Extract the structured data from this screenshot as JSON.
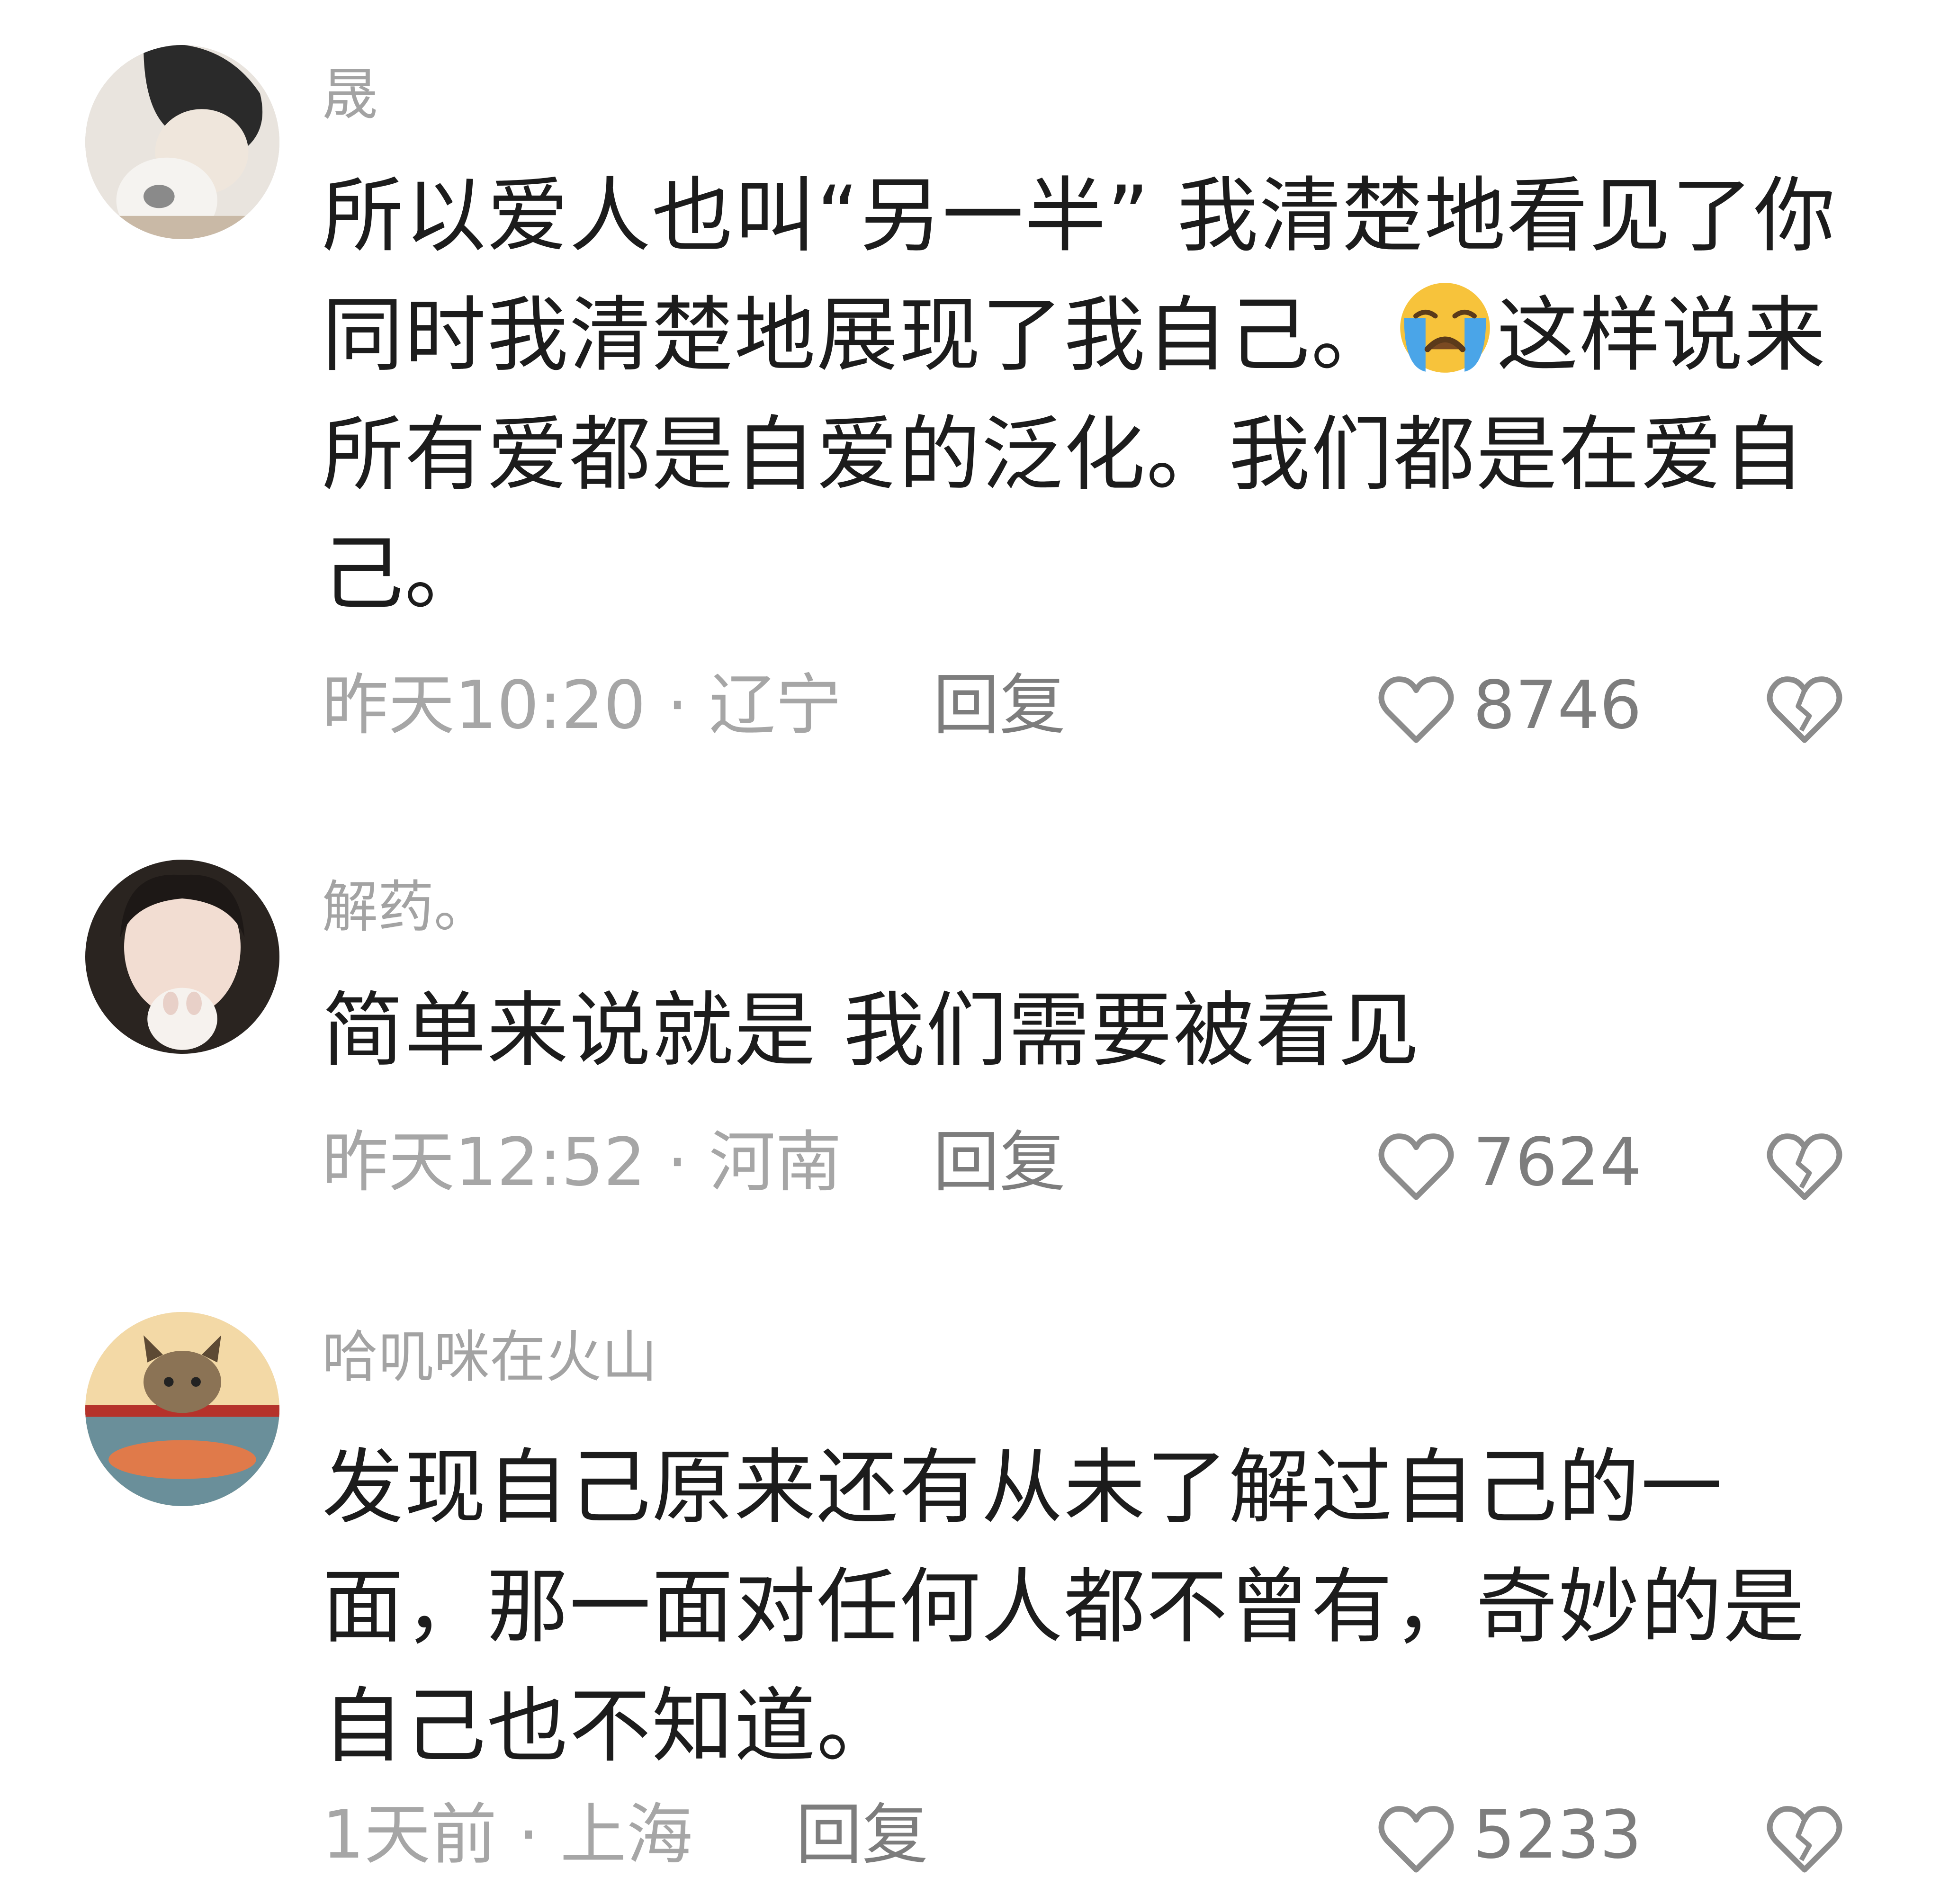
{
  "comments": [
    {
      "username": "晟",
      "text_before_emoji": "所以爱人也叫“另一半” 我清楚地看见了你同时我清楚地展现了我自己。",
      "emoji": "loudly-crying-face",
      "text_after_emoji": "这样说来所有爱都是自爱的泛化。我们都是在爱自己。",
      "time_location": "昨天10:20 · 辽宁",
      "reply_label": "回复",
      "likes": "8746"
    },
    {
      "username": "解药。",
      "text": "简单来说就是 我们需要被看见",
      "time_location": "昨天12:52 · 河南",
      "reply_label": "回复",
      "likes": "7624"
    },
    {
      "username": "哈叽咪在火山",
      "text": "发现自己原来还有从未了解过自己的一面，那一面对任何人都不曾有，奇妙的是自己也不知道。",
      "time_location": "1天前 · 上海",
      "reply_label": "回复",
      "likes": "5233"
    }
  ],
  "icons": {
    "like": "heart-outline-icon",
    "dislike": "broken-heart-icon"
  },
  "colors": {
    "text": "#1c1c1c",
    "username": "#a3a3a3",
    "meta": "#a6a6a6",
    "reply": "#7d7d7d"
  }
}
